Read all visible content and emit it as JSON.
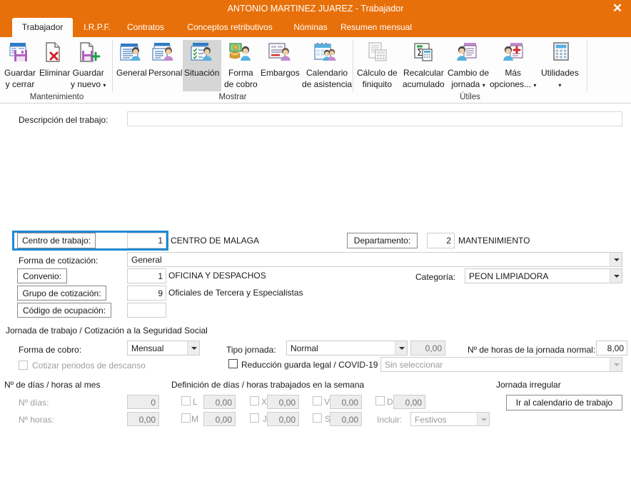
{
  "window": {
    "title": "ANTONIO MARTINEZ JUAREZ - Trabajador",
    "close_icon": "close-icon",
    "close_glyph": "✕",
    "accent": "#e8700a",
    "highlight": "#1f8ad2"
  },
  "tabs": [
    {
      "label": "Trabajador",
      "active": true
    },
    {
      "label": "I.R.P.F.",
      "active": false
    },
    {
      "label": "Contratos",
      "active": false
    },
    {
      "label": "Conceptos retributivos",
      "active": false
    },
    {
      "label": "Nóminas",
      "active": false
    },
    {
      "label": "Resumen mensual",
      "active": false
    }
  ],
  "ribbon": {
    "groups": [
      {
        "label": "Mantenimiento"
      },
      {
        "label": "Mostrar"
      },
      {
        "label": "Útiles"
      }
    ],
    "buttons": [
      {
        "label": "Guardar\ny cerrar",
        "icon": "save-close-icon",
        "state": "normal",
        "dropdown": false
      },
      {
        "label": "Eliminar",
        "icon": "delete-icon",
        "state": "normal",
        "dropdown": false
      },
      {
        "label": "Guardar\ny nuevo",
        "icon": "save-new-icon",
        "state": "normal",
        "dropdown": true
      },
      {
        "label": "General",
        "icon": "general-person-icon",
        "state": "normal",
        "dropdown": false
      },
      {
        "label": "Personal",
        "icon": "personal-person-icon",
        "state": "normal",
        "dropdown": false
      },
      {
        "label": "Situación",
        "icon": "situacion-person-icon",
        "state": "selected",
        "dropdown": false
      },
      {
        "label": "Forma\nde cobro",
        "icon": "payment-money-icon",
        "state": "normal",
        "dropdown": false
      },
      {
        "label": "Embargos",
        "icon": "embargo-icon",
        "state": "normal",
        "dropdown": false
      },
      {
        "label": "Calendario\nde asistencia",
        "icon": "calendar-attendance-icon",
        "state": "normal",
        "dropdown": false
      },
      {
        "label": "Cálculo de\nfiniquito",
        "icon": "settlement-calc-icon",
        "state": "disabled",
        "dropdown": false
      },
      {
        "label": "Recalcular\nacumulado",
        "icon": "recalculate-sigma-icon",
        "state": "normal",
        "dropdown": false
      },
      {
        "label": "Cambio de\njornada",
        "icon": "workday-change-icon",
        "state": "normal",
        "dropdown": true
      },
      {
        "label": "Más\nopciones...",
        "icon": "more-options-icon",
        "state": "normal",
        "dropdown": true
      },
      {
        "label": "Utilidades",
        "icon": "utilities-calculator-icon",
        "state": "normal",
        "dropdown": true
      }
    ]
  },
  "form": {
    "descripcion": {
      "label": "Descripción del trabajo:",
      "value": ""
    },
    "centro_trabajo": {
      "label": "Centro de trabajo:",
      "code": "1",
      "name": "CENTRO DE MALAGA",
      "highlighted": true
    },
    "departamento": {
      "label": "Departamento:",
      "code": "2",
      "name": "MANTENIMIENTO"
    },
    "forma_cotizacion": {
      "label": "Forma de cotización:",
      "value": "General"
    },
    "convenio": {
      "label": "Convenio:",
      "code": "1",
      "name": "OFICINA Y DESPACHOS"
    },
    "categoria": {
      "label": "Categoría:",
      "value": "PEON LIMPIADORA"
    },
    "grupo_cotizacion": {
      "label": "Grupo de cotización:",
      "code": "9",
      "name": "Oficiales de Tercera y Especialistas"
    },
    "codigo_ocupacion": {
      "label": "Código de ocupación:",
      "code": ""
    },
    "jornada_section": "Jornada de trabajo / Cotización a la Seguridad Social",
    "forma_cobro": {
      "label": "Forma de cobro:",
      "value": "Mensual"
    },
    "tipo_jornada": {
      "label": "Tipo jornada:",
      "value": "Normal",
      "pct": "0,00"
    },
    "horas_jornada": {
      "label": "Nº de horas de la jornada normal:",
      "value": "8,00"
    },
    "cotizar_descanso": {
      "label": "Cotizar periodos de descanso",
      "checked": false,
      "disabled": true
    },
    "reduccion": {
      "label": "Reducción guarda legal / COVID-19",
      "checked": false,
      "select_value": "Sin seleccionar"
    },
    "dias_mes": {
      "section": "Nº de días / horas al mes",
      "dias_label": "Nº días:",
      "dias_value": "0",
      "horas_label": "Nº horas:",
      "horas_value": "0,00"
    },
    "semana": {
      "section": "Definición de días / horas trabajados en la semana",
      "days": [
        {
          "key": "L",
          "value": "0,00",
          "checked": false
        },
        {
          "key": "M",
          "value": "0,00",
          "checked": false
        },
        {
          "key": "X",
          "value": "0,00",
          "checked": false
        },
        {
          "key": "J",
          "value": "0,00",
          "checked": false
        },
        {
          "key": "V",
          "value": "0,00",
          "checked": false
        },
        {
          "key": "S",
          "value": "0,00",
          "checked": false
        },
        {
          "key": "D",
          "value": "0,00",
          "checked": false
        }
      ],
      "incluir_label": "Incluir:",
      "incluir_value": "Festivos"
    },
    "jornada_irregular": {
      "section": "Jornada irregular",
      "button": "Ir al calendario de trabajo"
    }
  }
}
